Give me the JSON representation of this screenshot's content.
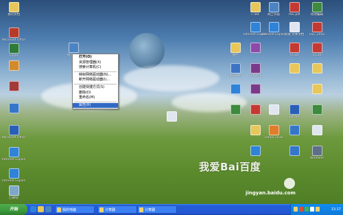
{
  "desktop_icons": [
    {
      "label": "我的文档",
      "color": "#e7c75a"
    },
    {
      "label": "Microsoft Office A",
      "color": "#b63a2a"
    },
    {
      "label": "Excel",
      "color": "#2d7b38"
    },
    {
      "label": "",
      "color": "#d28a2b"
    },
    {
      "label": "",
      "color": "#a23a3a"
    },
    {
      "label": "",
      "color": "#3576c9"
    },
    {
      "label": "Microsoft Office W",
      "color": "#2a5fb7"
    },
    {
      "label": "Internet Explorer",
      "color": "#2f83d8"
    },
    {
      "label": "Internet Explorer",
      "color": "#2f83d8"
    },
    {
      "label": "回收站",
      "color": "#7ea7c8"
    },
    {
      "label": "网上邻居",
      "color": "#4c84c3"
    },
    {
      "label": "FTB4",
      "color": "#e7c75a"
    },
    {
      "label": "网上邻居",
      "color": "#4c84c3"
    },
    {
      "label": "YOL.pdf",
      "color": "#c43a33"
    },
    {
      "label": "修改编辑",
      "color": "#3e8a3e"
    },
    {
      "label": "Internet Explorer",
      "color": "#2f83d8"
    },
    {
      "label": "Internet Explorer",
      "color": "#2f83d8"
    },
    {
      "label": "新建 文本文档",
      "color": "#dfe6ef"
    },
    {
      "label": "ESC_2050",
      "color": "#c43a33"
    },
    {
      "label": "图片",
      "color": "#e7c75a"
    },
    {
      "label": "",
      "color": "#8e4aa8"
    },
    {
      "label": "CC3a",
      "color": "#c43a33"
    },
    {
      "label": "CC3a",
      "color": "#c43a33"
    },
    {
      "label": "BiEGOUP",
      "color": "#3e74c4"
    },
    {
      "label": "BEXEtup",
      "color": "#7a3a8a"
    },
    {
      "label": "",
      "color": "#e7c75a"
    },
    {
      "label": "",
      "color": "#e7c75a"
    },
    {
      "label": "",
      "color": "#2f83d8"
    },
    {
      "label": "",
      "color": "#7a3a8a"
    },
    {
      "label": "",
      "color": "#e7c75a"
    },
    {
      "label": "",
      "color": "#3e8a3e"
    },
    {
      "label": "",
      "color": "#c43a33"
    },
    {
      "label": "",
      "color": "#dfe6ef"
    },
    {
      "label": "Ext.doc",
      "color": "#2a5fb7"
    },
    {
      "label": "",
      "color": "#3e8a3e"
    },
    {
      "label": "",
      "color": "#e7c75a"
    },
    {
      "label": "Fetion 2010",
      "color": "#e07c2a"
    },
    {
      "label": "",
      "color": "#3576c9"
    },
    {
      "label": "",
      "color": "#dfe6ef"
    },
    {
      "label": "",
      "color": "#2f83d8"
    },
    {
      "label": "",
      "color": "#3576c9"
    },
    {
      "label": "Winmine",
      "color": "#5f6f8a"
    },
    {
      "label": "",
      "color": "#dfe6ef"
    }
  ],
  "context_menu": [
    {
      "label": "打开(O)",
      "selected": false,
      "bold": true
    },
    {
      "label": "资源管理器(X)",
      "selected": false
    },
    {
      "label": "搜索计算机(C)",
      "selected": false
    },
    {
      "separator": true
    },
    {
      "label": "映射网络驱动器(N)...",
      "selected": false
    },
    {
      "label": "断开网络驱动器(I)...",
      "selected": false
    },
    {
      "separator": true
    },
    {
      "label": "创建快捷方式(S)",
      "selected": false
    },
    {
      "label": "删除(D)",
      "selected": false
    },
    {
      "label": "重命名(M)",
      "selected": false
    },
    {
      "separator": true
    },
    {
      "label": "属性(R)",
      "selected": true
    }
  ],
  "taskbar": {
    "start_label": "开始",
    "quick_launch": [
      {
        "name": "ie-quicklaunch-icon",
        "color": "#2f83d8"
      },
      {
        "name": "media-quicklaunch-icon",
        "color": "#e7c75a"
      },
      {
        "name": "desktop-quicklaunch-icon",
        "color": "#4c84c3"
      }
    ],
    "tasks": [
      {
        "label": "我的电脑"
      },
      {
        "label": "计算器"
      },
      {
        "label": "计算器"
      }
    ],
    "tray_icons": [
      {
        "color": "#f1d26b"
      },
      {
        "color": "#e04b3a"
      },
      {
        "color": "#3fb54a"
      },
      {
        "color": "#ffffff"
      },
      {
        "color": "#f1d26b"
      }
    ],
    "clock": "13:17"
  },
  "watermark": {
    "title": "我爱Bai百度",
    "url": "jingyan.baidu.com"
  },
  "colors": {
    "taskbar": "#245edb",
    "start": "#3c9a3c",
    "menu_highlight": "#316ac5"
  }
}
